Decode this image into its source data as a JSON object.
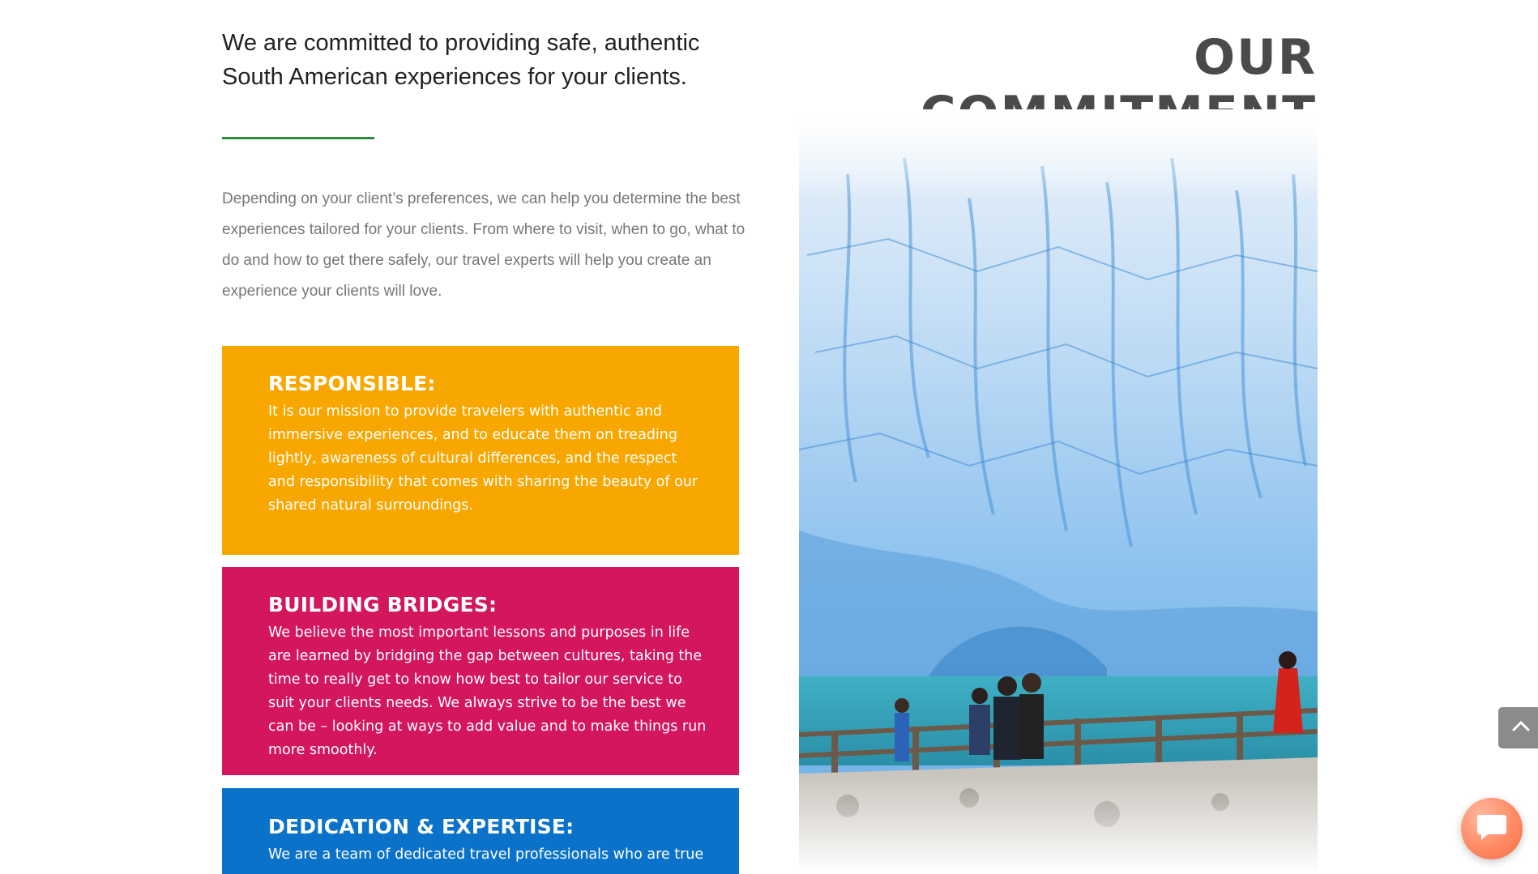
{
  "intro": {
    "heading": "We are committed to providing safe, authentic South American experiences for your clients.",
    "body": "Depending on your client’s preferences, we can help you determine the best experiences tailored for your clients. From where to visit, when to go, what to do and how to get there safely, our travel experts will help you create an experience your clients will love."
  },
  "section": {
    "title": "OUR COMMITMENT"
  },
  "cards": [
    {
      "title": "RESPONSIBLE:",
      "text": "It is our mission to provide travelers with authentic and immersive experiences, and to educate them on treading lightly, awareness of cultural differences, and the respect and responsibility that comes with sharing the beauty of our shared natural surroundings.",
      "color": "#f8a700"
    },
    {
      "title": "BUILDING BRIDGES:",
      "text": "We believe the most important lessons and purposes in life are learned by bridging the gap between cultures, taking the time to really get to know how best to tailor our service to suit your clients needs. We always strive to be the best we can be – looking at ways to add value and to make things run more smoothly.",
      "color": "#d3165e"
    },
    {
      "title": "DEDICATION & EXPERTISE:",
      "text": "We are a team of dedicated travel professionals who are true",
      "color": "#0a72c9"
    }
  ],
  "colors": {
    "divider": "#2e8b36",
    "title": "#4a4a4a",
    "chat": "#ff8a63"
  },
  "icons": {
    "back_to_top": "chevron-up-icon",
    "chat": "chat-bubble-icon"
  }
}
